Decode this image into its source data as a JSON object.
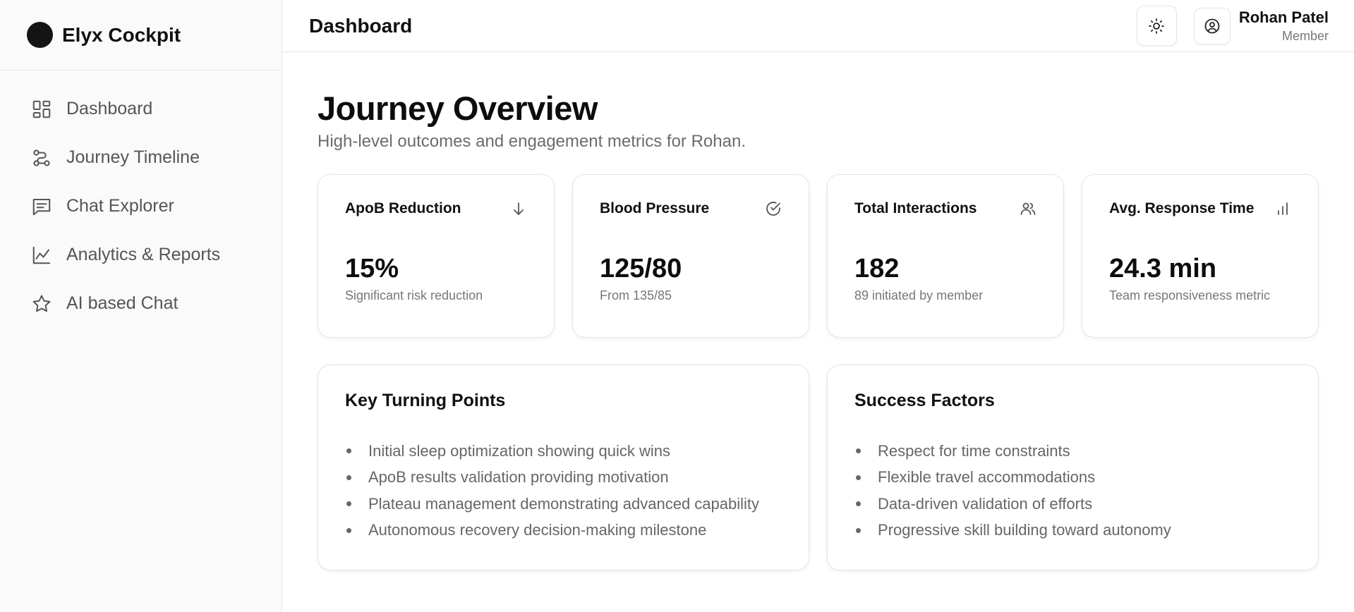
{
  "brand": {
    "name": "Elyx Cockpit"
  },
  "sidebar": {
    "items": [
      {
        "label": "Dashboard",
        "icon": "dashboard-grid-icon"
      },
      {
        "label": "Journey Timeline",
        "icon": "route-icon"
      },
      {
        "label": "Chat Explorer",
        "icon": "chat-icon"
      },
      {
        "label": "Analytics & Reports",
        "icon": "line-chart-icon"
      },
      {
        "label": "AI based Chat",
        "icon": "star-icon"
      }
    ]
  },
  "header": {
    "title": "Dashboard",
    "theme_icon": "sun-icon",
    "profile_icon": "user-circle-icon",
    "user": {
      "name": "Rohan Patel",
      "role": "Member"
    }
  },
  "main": {
    "title": "Journey Overview",
    "subtitle": "High-level outcomes and engagement metrics for Rohan.",
    "stats": [
      {
        "title": "ApoB Reduction",
        "icon": "arrow-down-icon",
        "value": "15%",
        "subtitle": "Significant risk reduction"
      },
      {
        "title": "Blood Pressure",
        "icon": "check-circle-icon",
        "value": "125/80",
        "subtitle": "From 135/85"
      },
      {
        "title": "Total Interactions",
        "icon": "users-icon",
        "value": "182",
        "subtitle": "89 initiated by member"
      },
      {
        "title": "Avg. Response Time",
        "icon": "bar-chart-icon",
        "value": "24.3 min",
        "subtitle": "Team responsiveness metric"
      }
    ],
    "key_turning_points": {
      "title": "Key Turning Points",
      "items": [
        "Initial sleep optimization showing quick wins",
        "ApoB results validation providing motivation",
        "Plateau management demonstrating advanced capability",
        "Autonomous recovery decision-making milestone"
      ]
    },
    "success_factors": {
      "title": "Success Factors",
      "items": [
        "Respect for time constraints",
        "Flexible travel accommodations",
        "Data-driven validation of efforts",
        "Progressive skill building toward autonomy"
      ]
    }
  },
  "colors": {
    "text_primary": "#111111",
    "text_muted": "#6b6b6b",
    "border": "#e5e5e5",
    "sidebar_bg": "#fafafa"
  }
}
